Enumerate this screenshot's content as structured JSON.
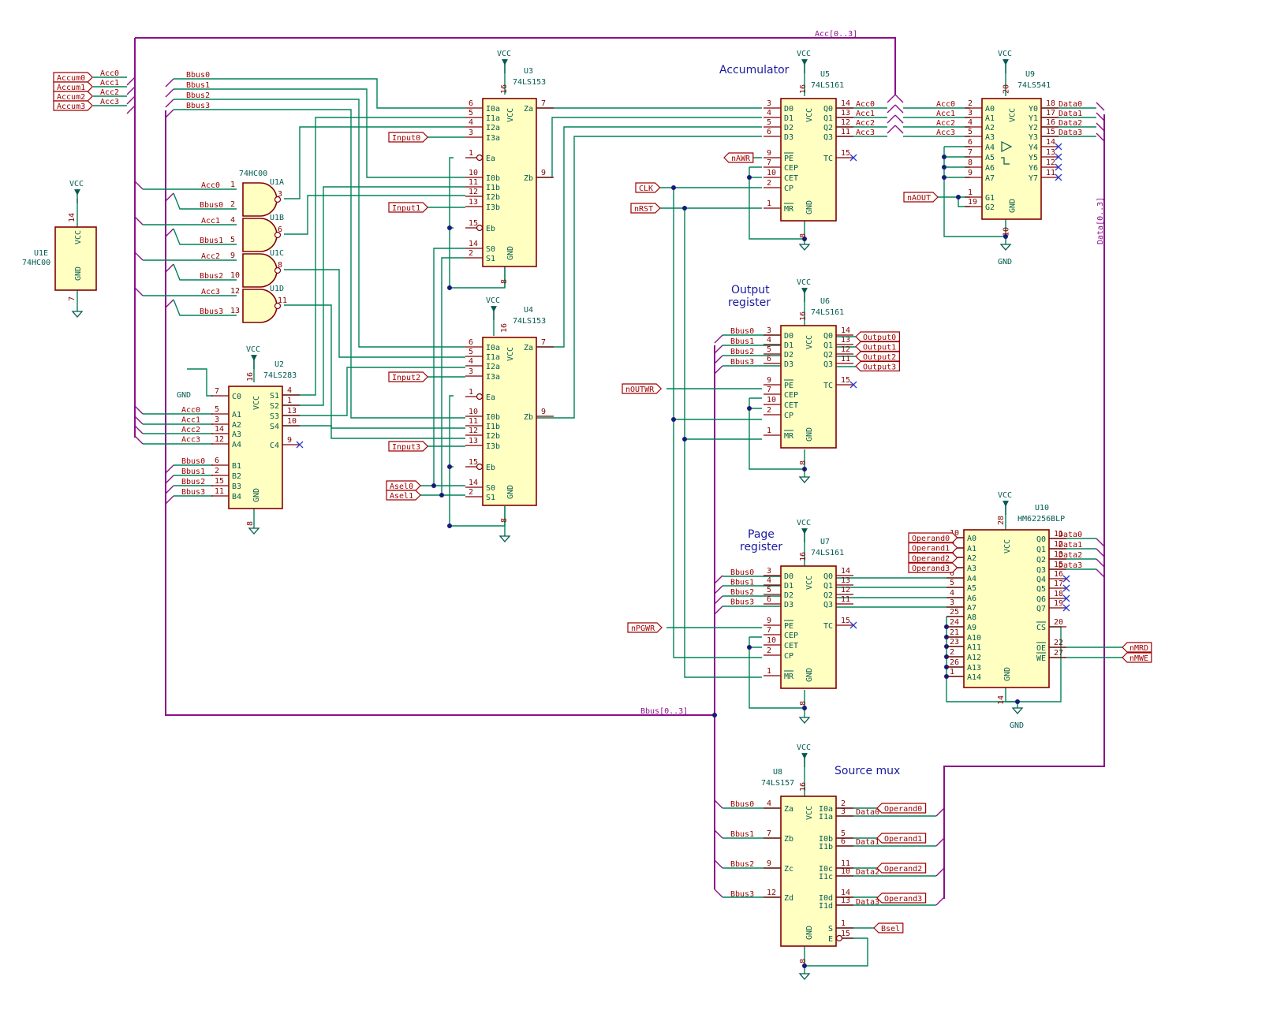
{
  "titles": {
    "accumulator": "Accumulator",
    "output_register_1": "Output",
    "output_register_2": "register",
    "page_register_1": "Page",
    "page_register_2": "register",
    "source_mux": "Source mux"
  },
  "power": {
    "vcc": "VCC",
    "gnd": "GND"
  },
  "buses": {
    "acc": "Acc[0..3]",
    "bbus": "Bbus[0..3]",
    "data": "Data[0..3]"
  },
  "global_labels": {
    "accum": [
      "Accum0",
      "Accum1",
      "Accum2",
      "Accum3"
    ],
    "inputs": [
      "Input0",
      "Input1",
      "Input2",
      "Input3"
    ],
    "asel": [
      "Asel0",
      "Asel1"
    ],
    "clk": "CLK",
    "nrst": "nRST",
    "nawr": "nAWR",
    "naout": "nAOUT",
    "noutwr": "nOUTWR",
    "npgwr": "nPGWR",
    "outputs": [
      "Output0",
      "Output1",
      "Output2",
      "Output3"
    ],
    "operands": [
      "Operand0",
      "Operand1",
      "Operand2",
      "Operand3"
    ],
    "nmrd": "nMRD",
    "nmwe": "nMWE",
    "bsel": "Bsel"
  },
  "nets": {
    "acc": [
      "Acc0",
      "Acc1",
      "Acc2",
      "Acc3"
    ],
    "bbus": [
      "Bbus0",
      "Bbus1",
      "Bbus2",
      "Bbus3"
    ],
    "data": [
      "Data0",
      "Data1",
      "Data2",
      "Data3"
    ]
  },
  "components": {
    "u1e": {
      "ref": "U1E",
      "value": "74HC00"
    },
    "u1": {
      "value": "74HC00",
      "gates": [
        "U1A",
        "U1B",
        "U1C",
        "U1D"
      ]
    },
    "u2": {
      "ref": "U2",
      "value": "74LS283"
    },
    "u3": {
      "ref": "U3",
      "value": "74LS153"
    },
    "u4": {
      "ref": "U4",
      "value": "74LS153"
    },
    "u5": {
      "ref": "U5",
      "value": "74LS161"
    },
    "u6": {
      "ref": "U6",
      "value": "74LS161"
    },
    "u7": {
      "ref": "U7",
      "value": "74LS161"
    },
    "u8": {
      "ref": "U8",
      "value": "74LS157"
    },
    "u9": {
      "ref": "U9",
      "value": "74LS541"
    },
    "u10": {
      "ref": "U10",
      "value": "HM62256BLP"
    }
  },
  "pins": {
    "mux153_left": [
      "I0a",
      "I1a",
      "I2a",
      "I3a",
      "Ea",
      "I0b",
      "I1b",
      "I2b",
      "I3b",
      "Eb",
      "S0",
      "S1"
    ],
    "mux153_left_nums": [
      "6",
      "5",
      "4",
      "3",
      "1",
      "10",
      "11",
      "12",
      "13",
      "15",
      "14",
      "2"
    ],
    "mux153_right": [
      "Za",
      "Zb"
    ],
    "mux153_right_nums": [
      "7",
      "9"
    ],
    "cnt161_left": [
      "D0",
      "D1",
      "D2",
      "D3",
      "PE",
      "CEP",
      "CET",
      "CP",
      "MR"
    ],
    "cnt161_left_nums": [
      "3",
      "4",
      "5",
      "6",
      "9",
      "7",
      "10",
      "2",
      "1"
    ],
    "cnt161_right": [
      "Q0",
      "Q1",
      "Q2",
      "Q3",
      "TC"
    ],
    "cnt161_right_nums": [
      "14",
      "13",
      "12",
      "11",
      "15"
    ],
    "add283_left": [
      "C0",
      "A1",
      "A2",
      "A3",
      "A4",
      "B1",
      "B2",
      "B3",
      "B4"
    ],
    "add283_left_nums": [
      "7",
      "5",
      "3",
      "14",
      "12",
      "6",
      "2",
      "15",
      "11"
    ],
    "add283_right": [
      "S1",
      "S2",
      "S3",
      "S4",
      "C4"
    ],
    "add283_right_nums": [
      "4",
      "1",
      "13",
      "10",
      "9"
    ],
    "buf541_left": [
      "A0",
      "A1",
      "A2",
      "A3",
      "A4",
      "A5",
      "A6",
      "A7",
      "G1",
      "G2"
    ],
    "buf541_left_nums": [
      "2",
      "3",
      "4",
      "5",
      "6",
      "7",
      "8",
      "9",
      "1",
      "19"
    ],
    "buf541_right": [
      "Y0",
      "Y1",
      "Y2",
      "Y3",
      "Y4",
      "Y5",
      "Y6",
      "Y7"
    ],
    "buf541_right_nums": [
      "18",
      "17",
      "16",
      "15",
      "14",
      "13",
      "12",
      "11"
    ],
    "ram_left": [
      "A0",
      "A1",
      "A2",
      "A3",
      "A4",
      "A5",
      "A6",
      "A7",
      "A8",
      "A9",
      "A10",
      "A11",
      "A12",
      "A13",
      "A14"
    ],
    "ram_left_nums": [
      "10",
      "9",
      "8",
      "7",
      "6",
      "5",
      "4",
      "3",
      "25",
      "24",
      "21",
      "23",
      "2",
      "26",
      "1"
    ],
    "ram_right": [
      "Q0",
      "Q1",
      "Q2",
      "Q3",
      "Q4",
      "Q5",
      "Q6",
      "Q7",
      "CS",
      "OE",
      "WE"
    ],
    "ram_right_nums": [
      "11",
      "12",
      "13",
      "15",
      "16",
      "17",
      "18",
      "19",
      "20",
      "22",
      "27"
    ],
    "mux157_left": [
      "Za",
      "Zb",
      "Zc",
      "Zd"
    ],
    "mux157_left_nums": [
      "4",
      "7",
      "9",
      "12"
    ],
    "mux157_right": [
      "I0a",
      "I1a",
      "I0b",
      "I1b",
      "I0c",
      "I1c",
      "I0d",
      "I1d",
      "S",
      "E"
    ],
    "mux157_right_nums": [
      "2",
      "3",
      "5",
      "6",
      "11",
      "10",
      "14",
      "13",
      "1",
      "15"
    ],
    "u1e_pins": [
      "VCC",
      "GND"
    ],
    "u1e_nums": [
      "14",
      "7"
    ],
    "nand_nums": [
      [
        "1",
        "2",
        "3"
      ],
      [
        "4",
        "5",
        "6"
      ],
      [
        "9",
        "10",
        "8"
      ],
      [
        "12",
        "13",
        "11"
      ]
    ],
    "vcc_pin": "VCC",
    "gnd_pin": "GND",
    "vcc_nums": {
      "u2": "16",
      "u3": "16",
      "u4": "16",
      "u5": "16",
      "u6": "16",
      "u7": "16",
      "u8": "16",
      "u9": "20",
      "u10": "28"
    },
    "gnd_nums": {
      "u2": "8",
      "u3": "8",
      "u4": "8",
      "u5": "8",
      "u6": "8",
      "u7": "8",
      "u8": "8",
      "u9": "10",
      "u10": "14"
    }
  }
}
